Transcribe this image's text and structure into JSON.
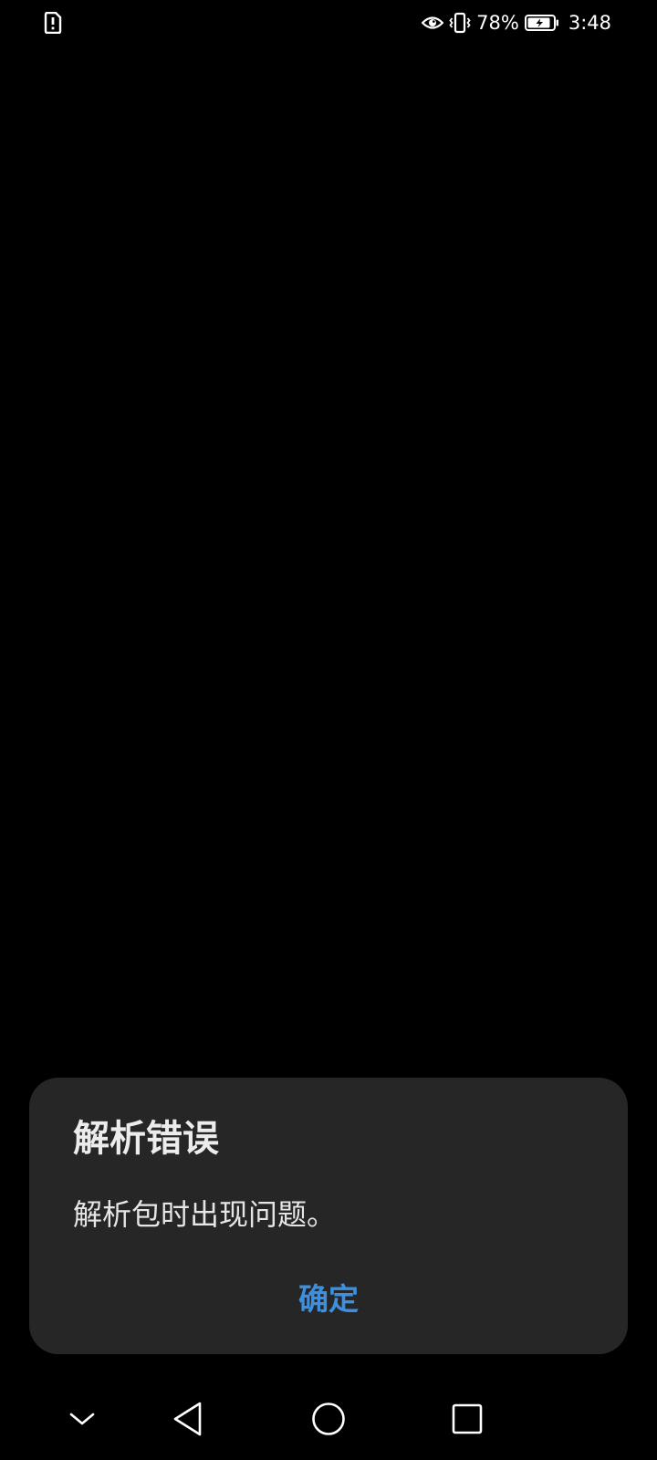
{
  "status_bar": {
    "left_icons": [
      "notification-alert-icon"
    ],
    "right_icons": [
      "eye-comfort-icon",
      "vibrate-icon",
      "battery-charging-icon"
    ],
    "battery_percent": "78%",
    "time": "3:48"
  },
  "dialog": {
    "title": "解析错误",
    "message": "解析包时出现问题。",
    "confirm_label": "确定"
  },
  "nav_bar": {
    "icons": [
      "hide-nav-chevron-icon",
      "back-icon",
      "home-icon",
      "recents-icon"
    ]
  },
  "colors": {
    "background": "#000000",
    "dialog_background": "#262626",
    "accent": "#3d8fe0",
    "text": "#ececec"
  }
}
